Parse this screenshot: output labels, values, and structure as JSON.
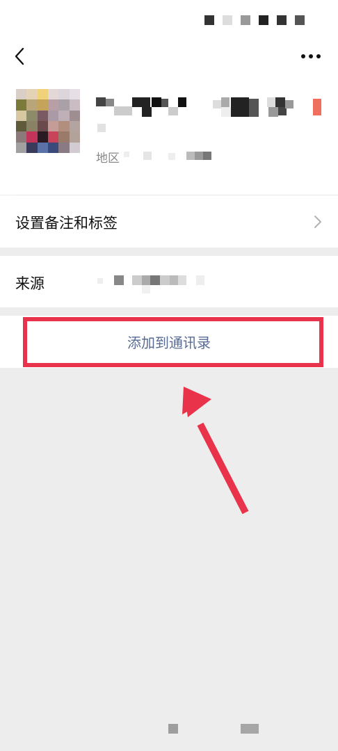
{
  "remark_row": {
    "label": "设置备注和标签"
  },
  "region": {
    "label": "地区"
  },
  "source_row": {
    "label": "来源"
  },
  "add_contact": {
    "label": "添加到通讯录"
  },
  "colors": {
    "link": "#576b95",
    "annotation": "#e8334a",
    "background": "#ededed"
  },
  "icons": {
    "back": "chevron-left-icon",
    "more": "more-dots-icon",
    "row_chevron": "chevron-right-icon"
  }
}
